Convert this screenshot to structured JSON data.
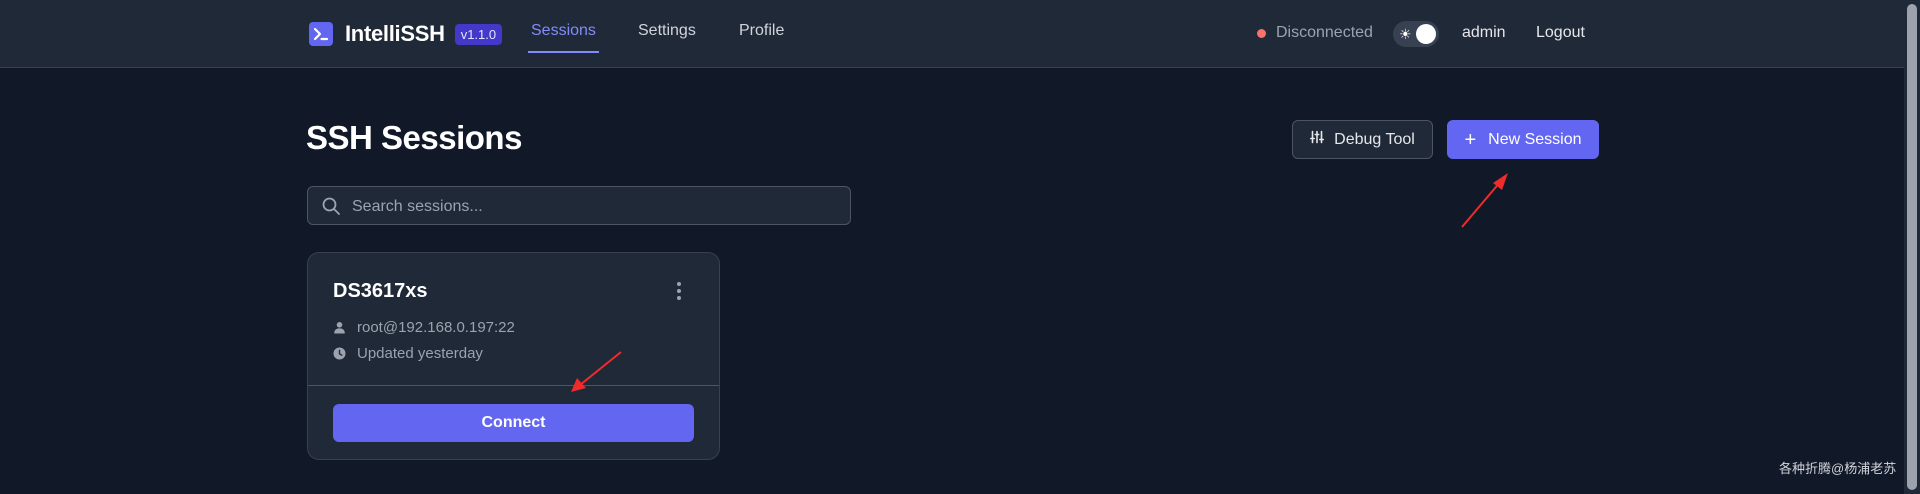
{
  "app": {
    "name": "IntelliSSH",
    "version": "v1.1.0"
  },
  "nav": {
    "tabs": [
      {
        "label": "Sessions",
        "active": true
      },
      {
        "label": "Settings",
        "active": false
      },
      {
        "label": "Profile",
        "active": false
      }
    ],
    "status": "Disconnected",
    "theme_toggle_icon": "☀",
    "user": "admin",
    "logout": "Logout"
  },
  "page": {
    "title": "SSH Sessions",
    "debug_button": "Debug Tool",
    "new_session_button": "New Session",
    "new_session_icon": "+",
    "search_placeholder": "Search sessions..."
  },
  "sessions": [
    {
      "name": "DS3617xs",
      "connection": "root@192.168.0.197:22",
      "updated": "Updated yesterday",
      "connect_label": "Connect"
    }
  ],
  "watermark": "各种折腾@杨浦老苏",
  "colors": {
    "background": "#111827",
    "surface": "#1f2937",
    "accent": "#6366f1",
    "accent_text": "#818cf8",
    "status_disconnected": "#f87171",
    "annotation_arrow": "#ef2b2b"
  },
  "icons": [
    "terminal-icon",
    "sun-icon",
    "sliders-icon",
    "plus-icon",
    "search-icon",
    "more-vertical-icon",
    "user-icon",
    "clock-icon"
  ]
}
